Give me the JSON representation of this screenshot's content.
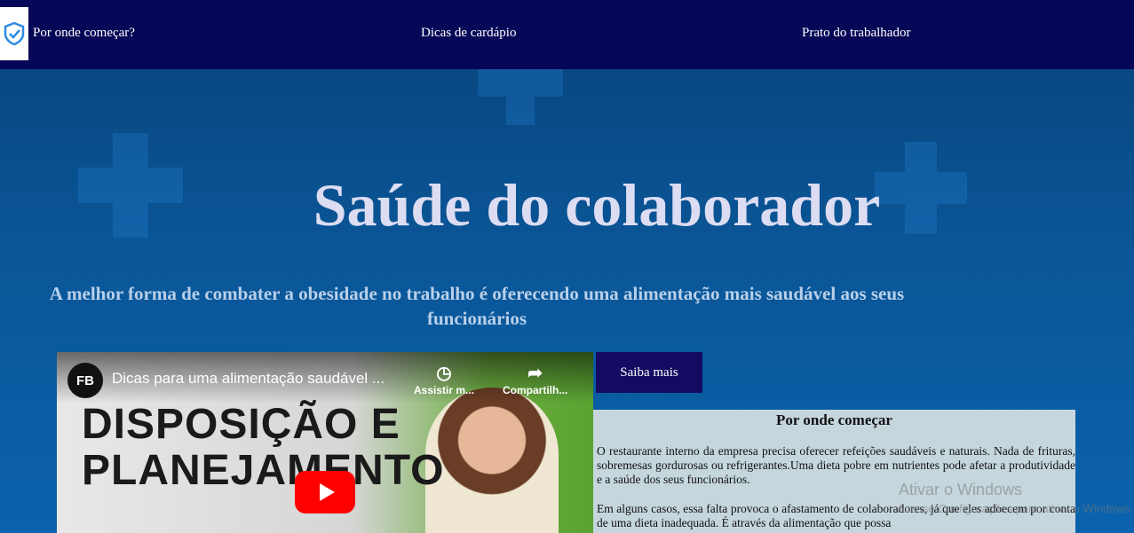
{
  "nav": {
    "logo_icon": "shield-check-icon",
    "items": [
      "Por onde começar?",
      "Dicas de cardápio",
      "Prato do trabalhador"
    ]
  },
  "hero": {
    "title": "Saúde do colaborador",
    "subtitle": "A melhor forma de combater a obesidade no trabalho é oferecendo uma alimentação mais saudável aos seus funcionários"
  },
  "video": {
    "channel": "FB",
    "title": "Dicas para uma alimentação saudável ...",
    "watch_later": "Assistir m...",
    "share": "Compartilh...",
    "thumbnail_text_line1": "DISPOSIÇÃO E",
    "thumbnail_text_line2": "PLANEJAMENTO"
  },
  "cta": {
    "label": "Saiba mais"
  },
  "info": {
    "title": "Por onde começar",
    "p1": "O restaurante interno da empresa precisa oferecer refeições saudáveis e naturais. Nada de frituras, sobremesas gordurosas ou refrigerantes.Uma dieta pobre em nutrientes pode afetar a produtividade e a saúde dos seus funcionários.",
    "p2": "Em alguns casos, essa falta provoca o afastamento de colaboradores, já que eles adoecem por conta de uma dieta inadequada. É através da alimentação que possa"
  },
  "watermark": {
    "line1": "Ativar o Windows",
    "line2": "Acesse Configurações para ativar o Windows."
  },
  "colors": {
    "navbar": "#070757",
    "button": "#140a62",
    "panel": "#c5d6dd"
  }
}
